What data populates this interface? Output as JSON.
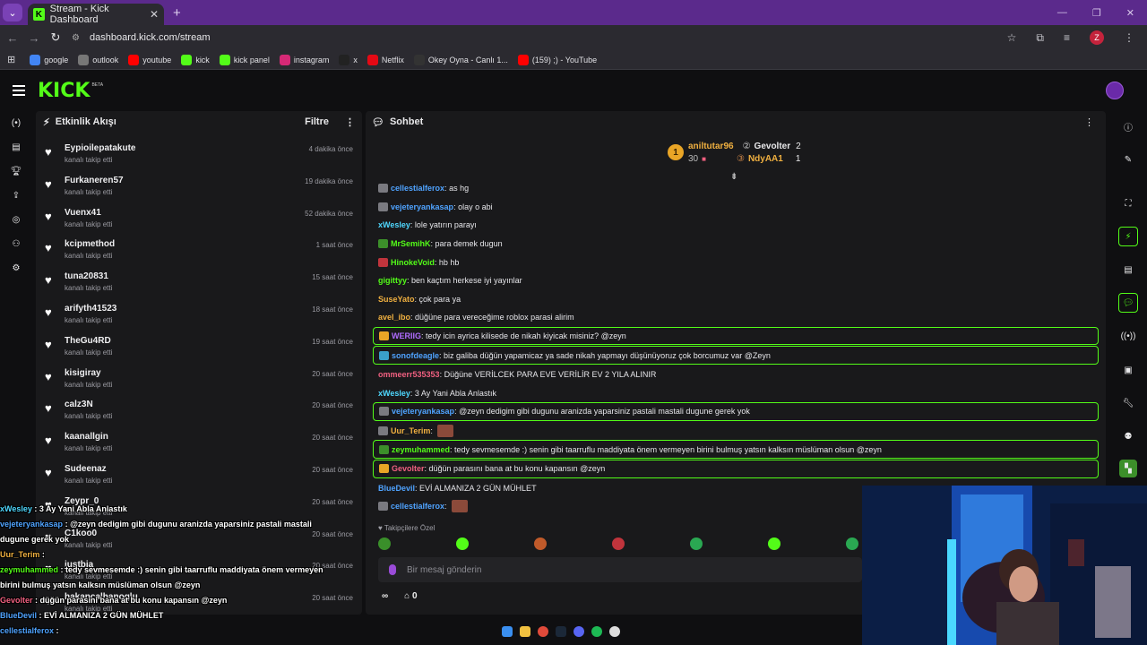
{
  "browser": {
    "tab_title": "Stream - Kick Dashboard",
    "url": "dashboard.kick.com/stream",
    "profile_initial": "Z",
    "bookmarks": [
      {
        "label": "google",
        "icon": "google-icon",
        "color": "#4285f4"
      },
      {
        "label": "outlook",
        "icon": "globe-icon",
        "color": "#777777"
      },
      {
        "label": "youtube",
        "icon": "youtube-icon",
        "color": "#ff0000"
      },
      {
        "label": "kick",
        "icon": "kick-icon",
        "color": "#53fc18"
      },
      {
        "label": "kick panel",
        "icon": "kick-icon",
        "color": "#53fc18"
      },
      {
        "label": "instagram",
        "icon": "instagram-icon",
        "color": "#d62976"
      },
      {
        "label": "x",
        "icon": "x-icon",
        "color": "#222222"
      },
      {
        "label": "Netflix",
        "icon": "netflix-icon",
        "color": "#e50914"
      },
      {
        "label": "Okey Oyna - Canlı 1...",
        "icon": "okey-icon",
        "color": "#333333"
      },
      {
        "label": "(159) ;) - YouTube",
        "icon": "youtube-icon",
        "color": "#ff0000"
      }
    ]
  },
  "header": {
    "logo": "KICK",
    "beta": "BETA"
  },
  "activity": {
    "title": "Etkinlik Akışı",
    "filter_label": "Filtre",
    "items": [
      {
        "name": "Eypioilepatakute",
        "action": "kanalı takip etti",
        "time": "4 dakika önce"
      },
      {
        "name": "Furkaneren57",
        "action": "kanalı takip etti",
        "time": "19 dakika önce"
      },
      {
        "name": "Vuenx41",
        "action": "kanalı takip etti",
        "time": "52 dakika önce"
      },
      {
        "name": "kcipmethod",
        "action": "kanalı takip etti",
        "time": "1 saat önce"
      },
      {
        "name": "tuna20831",
        "action": "kanalı takip etti",
        "time": "15 saat önce"
      },
      {
        "name": "arifyth41523",
        "action": "kanalı takip etti",
        "time": "18 saat önce"
      },
      {
        "name": "TheGu4RD",
        "action": "kanalı takip etti",
        "time": "19 saat önce"
      },
      {
        "name": "kisigiray",
        "action": "kanalı takip etti",
        "time": "20 saat önce"
      },
      {
        "name": "calz3N",
        "action": "kanalı takip etti",
        "time": "20 saat önce"
      },
      {
        "name": "kaanallgin",
        "action": "kanalı takip etti",
        "time": "20 saat önce"
      },
      {
        "name": "Sudeenaz",
        "action": "kanalı takip etti",
        "time": "20 saat önce"
      },
      {
        "name": "Zeypr_0",
        "action": "kanalı takip etti",
        "time": "20 saat önce"
      },
      {
        "name": "C1koo0",
        "action": "kanalı takip etti",
        "time": "20 saat önce"
      },
      {
        "name": "justbia",
        "action": "kanalı takip etti",
        "time": "20 saat önce"
      },
      {
        "name": "hakancalhanoglu",
        "action": "kanalı takip etti",
        "time": "20 saat önce"
      }
    ]
  },
  "chat": {
    "title": "Sohbet",
    "leaderboard": {
      "first": {
        "rank": "1",
        "name": "aniltutar96",
        "count": "30"
      },
      "second": {
        "name": "Gevolter",
        "count": "2"
      },
      "third": {
        "name": "NdyAA1",
        "count": "1"
      }
    },
    "messages": [
      {
        "user": "cellestialferox",
        "color": "#4fa3ff",
        "text": "as hg",
        "hl": false,
        "badge": "#7a7a80"
      },
      {
        "user": "vejeteryankasap",
        "color": "#4fa3ff",
        "text": "olay o abi",
        "hl": false,
        "badge": "#7a7a80"
      },
      {
        "user": "xWesley",
        "color": "#4fd8ff",
        "text": "lole yatırın parayı",
        "hl": false,
        "badge": ""
      },
      {
        "user": "MrSemihK",
        "color": "#53fc18",
        "text": "para demek dugun",
        "hl": false,
        "badge": "#3c8f2a"
      },
      {
        "user": "HinokeVoid",
        "color": "#53fc18",
        "text": "hb hb",
        "hl": false,
        "badge": "#c0343c"
      },
      {
        "user": "gigittyy",
        "color": "#53fc18",
        "text": "ben kaçtım herkese iyi yayınlar",
        "hl": false,
        "badge": ""
      },
      {
        "user": "SuseYato",
        "color": "#f0b040",
        "text": "çok para ya",
        "hl": false,
        "badge": ""
      },
      {
        "user": "avel_ibo",
        "color": "#f0b040",
        "text": "düğüne para vereceğime roblox parasi alirim",
        "hl": false,
        "badge": ""
      },
      {
        "user": "WERIIG",
        "color": "#b06cff",
        "text": "tedy icin ayrica kilisede de nikah kiyicak misiniz? @zeyn",
        "hl": true,
        "badge": "#e9a526"
      },
      {
        "user": "sonofdeagle",
        "color": "#4fa3ff",
        "text": "biz galiba düğün yapamicaz ya sade nikah yapmayı düşünüyoruz çok borcumuz var @Zeyn",
        "hl": true,
        "badge": "#3aa0c8"
      },
      {
        "user": "ommeerr535353",
        "color": "#f06080",
        "text": "Düğüne VERİLCEK PARA EVE VERİLİR EV 2 YILA ALINIR",
        "hl": false,
        "badge": ""
      },
      {
        "user": "xWesley",
        "color": "#4fd8ff",
        "text": "3 Ay Yani Abla Anlastık",
        "hl": false,
        "badge": ""
      },
      {
        "user": "vejeteryankasap",
        "color": "#4fa3ff",
        "text": "@zeyn dedigim gibi dugunu aranizda yaparsiniz pastali mastali dugune gerek yok",
        "hl": true,
        "badge": "#7a7a80"
      },
      {
        "user": "Uur_Terim",
        "color": "#f0b040",
        "text": "",
        "hl": false,
        "badge": "#7a7a80",
        "emote": true
      },
      {
        "user": "zeymuhammed",
        "color": "#53fc18",
        "text": "tedy sevmesemde :) senin gibi taarruflu maddiyata önem vermeyen birini bulmuş yatsın kalksın müslüman olsun @zeyn",
        "hl": true,
        "badge": "#3c8f2a"
      },
      {
        "user": "Gevolter",
        "color": "#f06080",
        "text": "düğün parasını bana at bu konu kapansın @zeyn",
        "hl": true,
        "badge": "#e9a526"
      },
      {
        "user": "BlueDevil",
        "color": "#4fa3ff",
        "text": "EVİ ALMANIZA 2 GÜN MÜHLET",
        "hl": false,
        "badge": ""
      },
      {
        "user": "cellestialferox",
        "color": "#4fa3ff",
        "text": "",
        "hl": false,
        "badge": "#7a7a80",
        "emote": true
      }
    ],
    "followers_label": "Takipçilere Özel",
    "input_placeholder": "Bir mesaj gönderin",
    "points_count": "0"
  },
  "overlay": [
    {
      "user": "xWesley",
      "color": "#4fd8ff",
      "text": "3 Ay Yani Abla Anlastık"
    },
    {
      "user": "vejeteryankasap",
      "color": "#4fa3ff",
      "text": "@zeyn dedigim gibi dugunu aranizda yaparsiniz pastali mastali dugune gerek yok"
    },
    {
      "user": "Uur_Terim",
      "color": "#f0b040",
      "text": ""
    },
    {
      "user": "zeymuhammed",
      "color": "#53fc18",
      "text": "tedy sevmesemde :) senin gibi taarruflu maddiyata önem vermeyen birini bulmuş yatsın kalksın müslüman olsun @zeyn"
    },
    {
      "user": "Gevolter",
      "color": "#f06080",
      "text": "düğün parasını bana at bu konu kapansın @zeyn"
    },
    {
      "user": "BlueDevil",
      "color": "#4fa3ff",
      "text": "EVİ ALMANIZA 2 GÜN MÜHLET"
    },
    {
      "user": "cellestialferox",
      "color": "#4fa3ff",
      "text": ""
    }
  ],
  "colors": {
    "accent": "#53fc18",
    "tab_bar": "#5b2a8c"
  }
}
